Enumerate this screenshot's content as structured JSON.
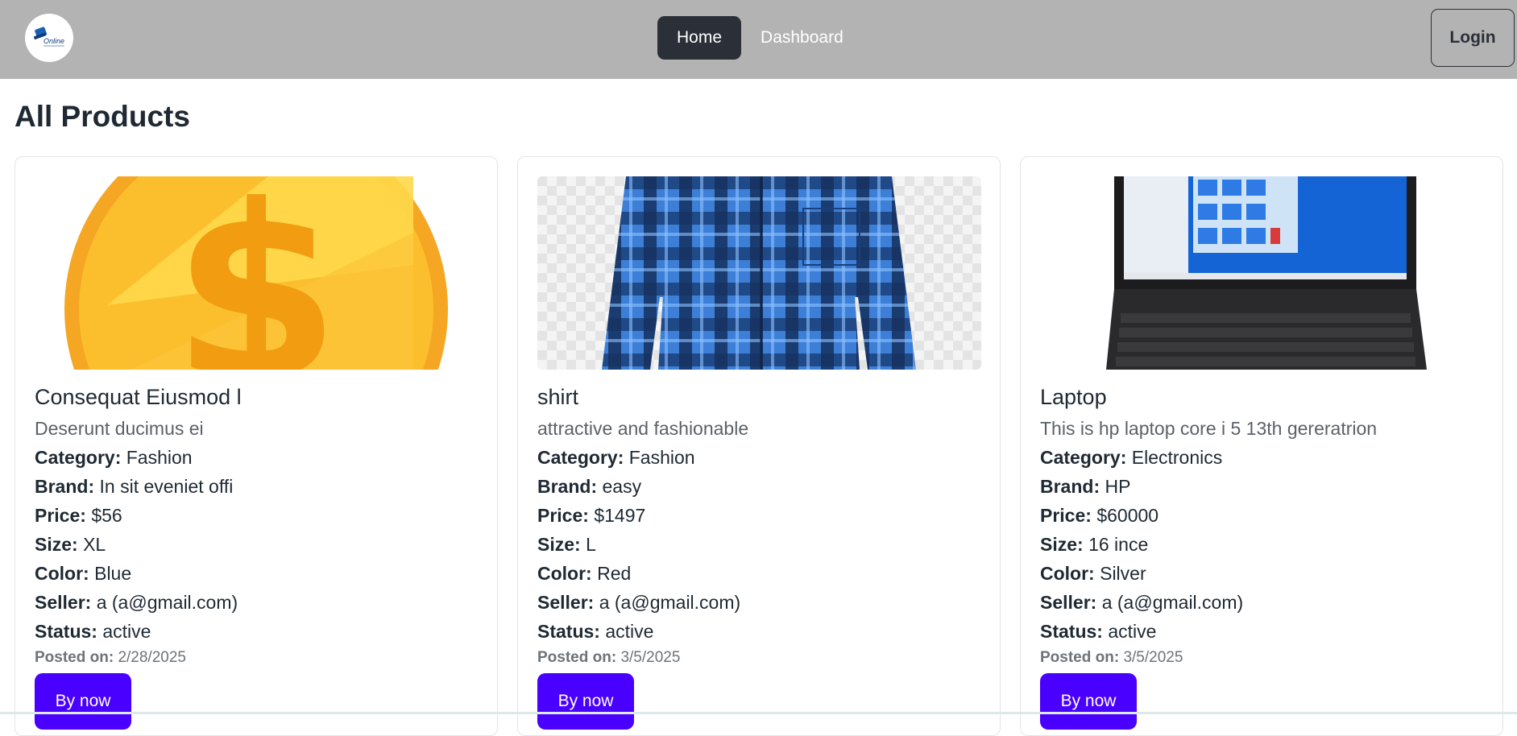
{
  "nav": {
    "logo_text": "Online",
    "links": [
      {
        "label": "Home",
        "active": true
      },
      {
        "label": "Dashboard",
        "active": false
      }
    ],
    "login_label": "Login"
  },
  "page": {
    "title": "All Products"
  },
  "labels": {
    "category": "Category:",
    "brand": "Brand:",
    "price": "Price:",
    "size": "Size:",
    "color": "Color:",
    "seller": "Seller:",
    "status": "Status:",
    "posted_on": "Posted on:",
    "buy_button": "By now"
  },
  "products": [
    {
      "image": "gold-coin-image",
      "title": "Consequat Eiusmod l",
      "description": "Deserunt ducimus ei",
      "category": "Fashion",
      "brand": "In sit eveniet offi",
      "price": "$56",
      "size": "XL",
      "color": "Blue",
      "seller": "a (a@gmail.com)",
      "status": "active",
      "posted_on": "2/28/2025"
    },
    {
      "image": "plaid-shirt-image",
      "title": "shirt",
      "description": "attractive and fashionable",
      "category": "Fashion",
      "brand": "easy",
      "price": "$1497",
      "size": "L",
      "color": "Red",
      "seller": "a (a@gmail.com)",
      "status": "active",
      "posted_on": "3/5/2025"
    },
    {
      "image": "laptop-image",
      "title": "Laptop",
      "description": "This is hp laptop core i 5 13th gereratrion",
      "category": "Electronics",
      "brand": "HP",
      "price": "$60000",
      "size": "16 ince",
      "color": "Silver",
      "seller": "a (a@gmail.com)",
      "status": "active",
      "posted_on": "3/5/2025"
    }
  ],
  "colors": {
    "navbar": "#b3b3b3",
    "active_link": "#2b3038",
    "buy_button": "#4a00ff"
  }
}
